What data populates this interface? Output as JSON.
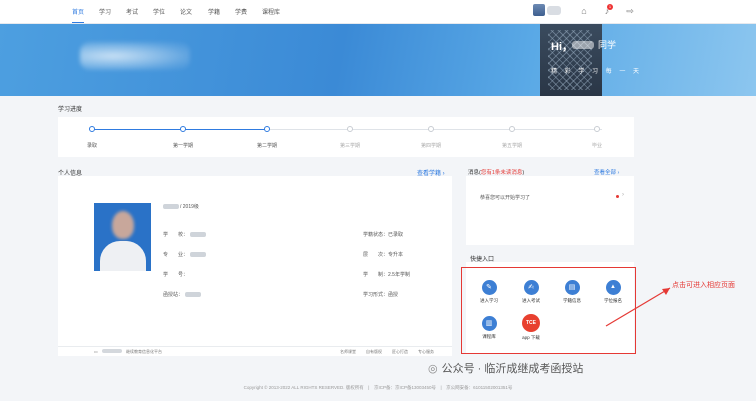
{
  "nav": {
    "items": [
      "首页",
      "学习",
      "考试",
      "学位",
      "论文",
      "学籍",
      "学费",
      "课程库"
    ]
  },
  "banner": {
    "greeting": "Hi，",
    "greeting_suffix": "同学",
    "slogan": "精 彩 学 习 每 一 天"
  },
  "progress": {
    "title": "学习进度",
    "steps": [
      "录取",
      "第一学期",
      "第二学期",
      "第三学期",
      "第四学期",
      "第五学期",
      "毕业"
    ],
    "completed_steps": 3
  },
  "personal": {
    "title": "个人信息",
    "view_link": "查看学籍 ›",
    "grade": "/ 2019级",
    "rows": {
      "school": "学　　校：",
      "major": "专　　业：",
      "student_no": "学　　号：",
      "center": "函授站：",
      "status": "学籍状态：已录取",
      "level": "层　　次：专升本",
      "system": "学　　制：2.5年学制",
      "mode": "学习形式：函授"
    },
    "footer_left": "继续教育信息化平台",
    "footer_links": [
      "名师课堂",
      "自有版权",
      "匠心打造",
      "专心服务"
    ]
  },
  "messages": {
    "title_prefix": "消息(",
    "title_unread": "您有1条未读消息",
    "title_suffix": ")",
    "view_all": "查看全部 ›",
    "items": [
      "恭喜您可以开始学习了"
    ]
  },
  "quick": {
    "title": "快捷入口",
    "items": [
      {
        "label": "进入学习",
        "icon": "✎"
      },
      {
        "label": "进入考试",
        "icon": "✍"
      },
      {
        "label": "学籍信息",
        "icon": "▤"
      },
      {
        "label": "学位报名",
        "icon": "🎓"
      },
      {
        "label": "课程库",
        "icon": "▥"
      },
      {
        "label": "app 下载",
        "icon": "TCE"
      }
    ]
  },
  "annotation": "点击可进入相应页面",
  "watermark": "公众号 · 临沂成继成考函授站",
  "copyright": "Copyright © 2013-2022 ALL RIGHTS RESERVED. 版权所有　|　京ICP备：京ICP备13003450号　|　京公网安备：61011502001351号",
  "colors": {
    "accent": "#2f7be0",
    "alert": "#e53935"
  }
}
